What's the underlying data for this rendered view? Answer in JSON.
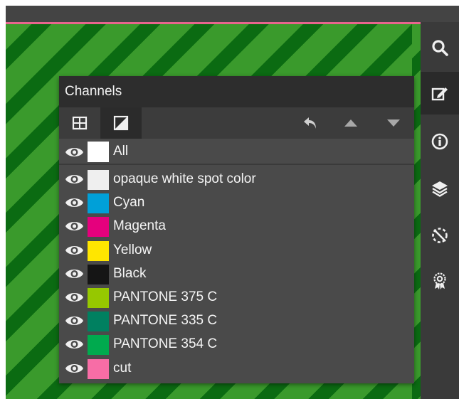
{
  "panel": {
    "title": "Channels",
    "all_label": "All",
    "all_color": "#ffffff"
  },
  "toolbar": {
    "tools": [
      {
        "icon": "grid-view-icon"
      },
      {
        "icon": "contrast-view-icon"
      }
    ],
    "right_icons": [
      "undo-icon",
      "move-up-icon",
      "move-down-icon"
    ]
  },
  "channels": [
    {
      "label": "opaque white spot color",
      "color": "#efefef"
    },
    {
      "label": "Cyan",
      "color": "#00a0d8"
    },
    {
      "label": "Magenta",
      "color": "#e5007d"
    },
    {
      "label": "Yellow",
      "color": "#ffe600"
    },
    {
      "label": "Black",
      "color": "#151515"
    },
    {
      "label": "PANTONE 375 C",
      "color": "#96c800"
    },
    {
      "label": "PANTONE 335 C",
      "color": "#008060"
    },
    {
      "label": "PANTONE 354 C",
      "color": "#00aa4e"
    },
    {
      "label": "cut",
      "color": "#f76da6"
    }
  ],
  "sidebar": {
    "icons": [
      "search-icon",
      "edit-icon",
      "info-icon",
      "layers-icon",
      "separations-icon",
      "certificate-icon"
    ]
  },
  "colors": {
    "canvas_green": "#3a9a2c",
    "canvas_dark_green": "#0b6b12",
    "cut_line": "#e8658e"
  }
}
